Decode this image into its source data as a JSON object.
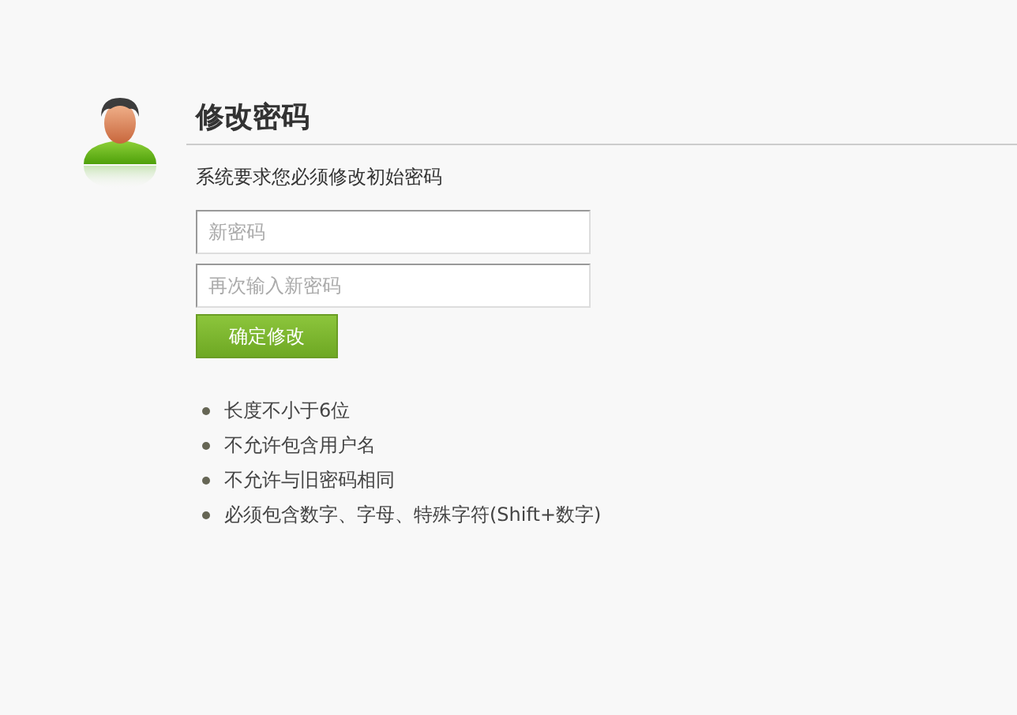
{
  "title": "修改密码",
  "notice": "系统要求您必须修改初始密码",
  "fields": [
    {
      "placeholder": "新密码"
    },
    {
      "placeholder": "再次输入新密码"
    }
  ],
  "submit_button": "确定修改",
  "rules": [
    "长度不小于6位",
    "不允许包含用户名",
    "不允许与旧密码相同",
    "必须包含数字、字母、特殊字符(Shift+数字)"
  ]
}
